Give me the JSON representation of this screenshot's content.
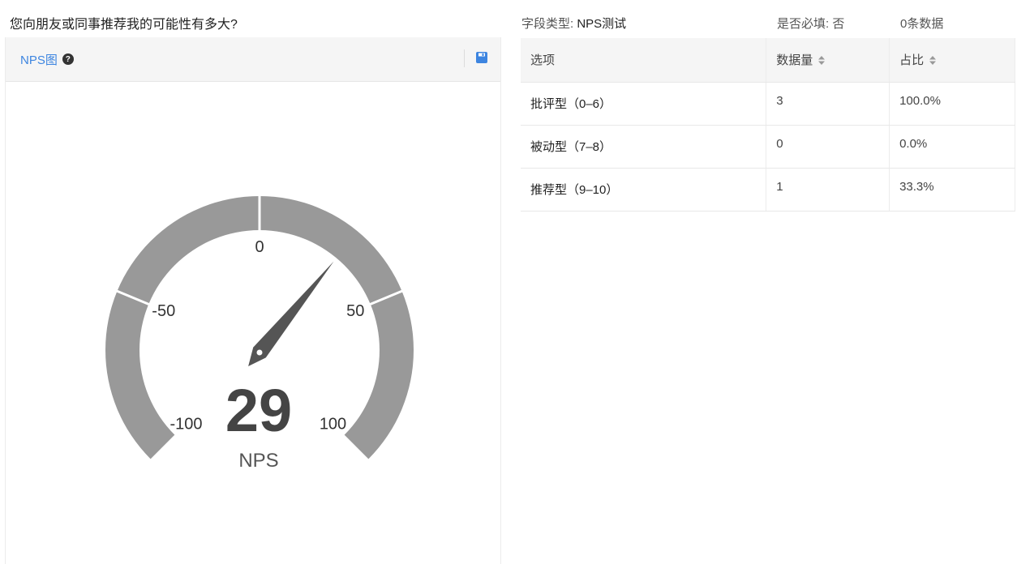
{
  "question": "您向朋友或同事推荐我的可能性有多大?",
  "chart_panel": {
    "title": "NPS图",
    "help_icon": "question-circle-icon",
    "save_icon": "floppy-disk-icon",
    "accent_color": "#3d85e0"
  },
  "chart_data": {
    "type": "gauge",
    "min": -100,
    "max": 100,
    "value": 29,
    "value_label": "NPS",
    "ticks": [
      -100,
      -50,
      0,
      50,
      100
    ],
    "tick_labels": [
      "-100",
      "-50",
      "0",
      "50",
      "100"
    ],
    "arc_color": "#999999",
    "pointer_color": "#555555"
  },
  "meta": {
    "field_type_label": "字段类型:",
    "field_type_value": "NPS测试",
    "required_label": "是否必填:",
    "required_value": "否",
    "count_text": "0条数据"
  },
  "table": {
    "headers": [
      "选项",
      "数据量",
      "占比"
    ],
    "sort_icon": "sort-arrows-icon",
    "rows": [
      {
        "option": "批评型（0–6）",
        "count": "3",
        "ratio": "100.0%"
      },
      {
        "option": "被动型（7–8）",
        "count": "0",
        "ratio": "0.0%"
      },
      {
        "option": "推荐型（9–10）",
        "count": "1",
        "ratio": "33.3%"
      }
    ]
  }
}
